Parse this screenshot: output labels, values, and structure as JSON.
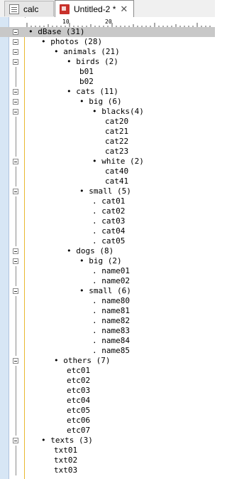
{
  "tabs": [
    {
      "label": "calc",
      "active": false
    },
    {
      "label": "Untitled-2 *",
      "active": true
    }
  ],
  "close_glyph": "✕",
  "ruler": {
    "marks": [
      "10",
      "20"
    ]
  },
  "rows": [
    {
      "text": "• dBase (31)",
      "indent": 0,
      "fold": true,
      "selected": true
    },
    {
      "text": "• photos (28)",
      "indent": 1,
      "fold": true
    },
    {
      "text": "• animals (21)",
      "indent": 2,
      "fold": true
    },
    {
      "text": "• birds (2)",
      "indent": 3,
      "fold": true
    },
    {
      "text": "b01",
      "indent": 4,
      "fold": false
    },
    {
      "text": "b02",
      "indent": 4,
      "fold": false
    },
    {
      "text": "• cats (11)",
      "indent": 3,
      "fold": true
    },
    {
      "text": "• big (6)",
      "indent": 4,
      "fold": true
    },
    {
      "text": "• blacks(4)",
      "indent": 5,
      "fold": true
    },
    {
      "text": "cat20",
      "indent": 6,
      "fold": false
    },
    {
      "text": "cat21",
      "indent": 6,
      "fold": false
    },
    {
      "text": "cat22",
      "indent": 6,
      "fold": false
    },
    {
      "text": "cat23",
      "indent": 6,
      "fold": false
    },
    {
      "text": "• white (2)",
      "indent": 5,
      "fold": true
    },
    {
      "text": "cat40",
      "indent": 6,
      "fold": false
    },
    {
      "text": "cat41",
      "indent": 6,
      "fold": false
    },
    {
      "text": "• small (5)",
      "indent": 4,
      "fold": true
    },
    {
      "text": ". cat01",
      "indent": 5,
      "fold": false
    },
    {
      "text": ". cat02",
      "indent": 5,
      "fold": false
    },
    {
      "text": ". cat03",
      "indent": 5,
      "fold": false
    },
    {
      "text": ". cat04",
      "indent": 5,
      "fold": false
    },
    {
      "text": ". cat05",
      "indent": 5,
      "fold": false
    },
    {
      "text": "• dogs (8)",
      "indent": 3,
      "fold": true
    },
    {
      "text": "• big (2)",
      "indent": 4,
      "fold": true
    },
    {
      "text": ". name01",
      "indent": 5,
      "fold": false
    },
    {
      "text": ". name02",
      "indent": 5,
      "fold": false
    },
    {
      "text": "• small (6)",
      "indent": 4,
      "fold": true
    },
    {
      "text": ". name80",
      "indent": 5,
      "fold": false
    },
    {
      "text": ". name81",
      "indent": 5,
      "fold": false
    },
    {
      "text": ". name82",
      "indent": 5,
      "fold": false
    },
    {
      "text": ". name83",
      "indent": 5,
      "fold": false
    },
    {
      "text": ". name84",
      "indent": 5,
      "fold": false
    },
    {
      "text": ". name85",
      "indent": 5,
      "fold": false
    },
    {
      "text": "• others (7)",
      "indent": 2,
      "fold": true
    },
    {
      "text": "etc01",
      "indent": 3,
      "fold": false
    },
    {
      "text": "etc02",
      "indent": 3,
      "fold": false
    },
    {
      "text": "etc03",
      "indent": 3,
      "fold": false
    },
    {
      "text": "etc04",
      "indent": 3,
      "fold": false
    },
    {
      "text": "etc05",
      "indent": 3,
      "fold": false
    },
    {
      "text": "etc06",
      "indent": 3,
      "fold": false
    },
    {
      "text": "etc07",
      "indent": 3,
      "fold": false
    },
    {
      "text": "• texts (3)",
      "indent": 1,
      "fold": true
    },
    {
      "text": "txt01",
      "indent": 2,
      "fold": false
    },
    {
      "text": "txt02",
      "indent": 2,
      "fold": false
    },
    {
      "text": "txt03",
      "indent": 2,
      "fold": false
    }
  ]
}
